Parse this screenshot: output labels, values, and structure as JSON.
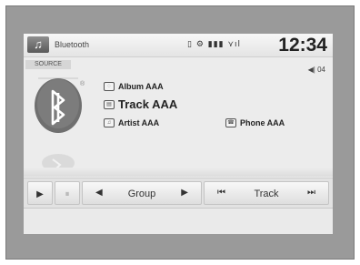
{
  "status_bar": {
    "app_icon_glyph": "♫",
    "title": "Bluetooth",
    "indicators": "▯ ⚙ ▮▮▮ ⋎ıl",
    "clock": "12:34"
  },
  "source_label": "SOURCE",
  "track_counter": "◀| 04",
  "now_playing": {
    "album": "Album AAA",
    "track": "Track AAA",
    "artist": "Artist AAA",
    "phone": "Phone AAA",
    "icons": {
      "album": "◌",
      "track": "▤",
      "artist": "♫",
      "phone": "☎"
    }
  },
  "controls": {
    "play_glyph": "▶",
    "pause_glyph": "⏸",
    "group_prev_glyph": "◀",
    "group_label": "Group",
    "group_next_glyph": "▶",
    "track_prev_glyph": "⏮",
    "track_label": "Track",
    "track_next_glyph": "⏭"
  },
  "colors": {
    "frame": "#9a9a9a",
    "screen": "#ececec",
    "bluetooth_badge": "#6f6f6f"
  }
}
